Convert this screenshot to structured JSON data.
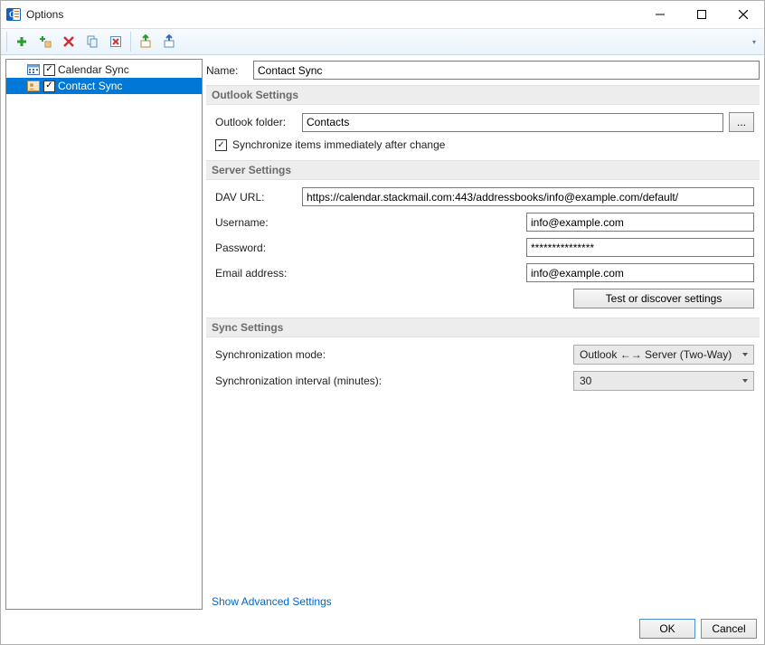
{
  "window": {
    "title": "Options"
  },
  "toolbar_icons": [
    "add",
    "add-multi",
    "delete",
    "copy",
    "clear",
    "import",
    "export"
  ],
  "tree": {
    "items": [
      {
        "label": "Calendar Sync",
        "checked": true,
        "selected": false,
        "icon": "calendar"
      },
      {
        "label": "Contact Sync",
        "checked": true,
        "selected": true,
        "icon": "contacts"
      }
    ]
  },
  "form": {
    "name_label": "Name:",
    "name_value": "Contact Sync",
    "sections": {
      "outlook": {
        "title": "Outlook Settings",
        "folder_label": "Outlook folder:",
        "folder_value": "Contacts",
        "browse_btn": "...",
        "sync_immediate_checked": true,
        "sync_immediate_label": "Synchronize items immediately after change"
      },
      "server": {
        "title": "Server Settings",
        "dav_label": "DAV URL:",
        "dav_value": "https://calendar.stackmail.com:443/addressbooks/info@example.com/default/",
        "user_label": "Username:",
        "user_value": "info@example.com",
        "pass_label": "Password:",
        "pass_value": "***************",
        "email_label": "Email address:",
        "email_value": "info@example.com",
        "test_btn": "Test or discover settings"
      },
      "sync": {
        "title": "Sync Settings",
        "mode_label": "Synchronization mode:",
        "mode_value": "Outlook ←→ Server (Two-Way)",
        "interval_label": "Synchronization interval (minutes):",
        "interval_value": "30"
      }
    },
    "advanced_link": "Show Advanced Settings"
  },
  "footer": {
    "ok": "OK",
    "cancel": "Cancel"
  }
}
